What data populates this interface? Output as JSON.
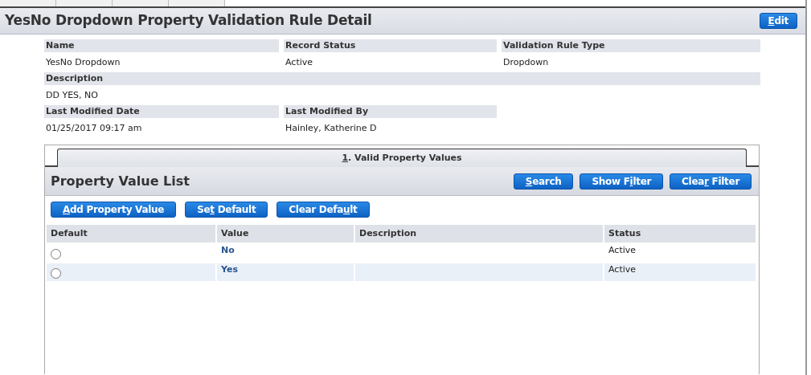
{
  "window": {
    "title": "YesNo Dropdown Property Validation Rule Detail"
  },
  "header_buttons": [
    {
      "key": "E",
      "post": "dit"
    }
  ],
  "details": [
    [
      {
        "label": "Name",
        "value": "YesNo Dropdown"
      },
      {
        "label": "Record Status",
        "value": "Active"
      },
      {
        "label": "Validation Rule Type",
        "value": "Dropdown"
      }
    ],
    [
      {
        "label": "Description",
        "value": "DD YES, NO"
      }
    ],
    [
      {
        "label": "Last Modified Date",
        "value": "01/25/2017 09:17 am"
      },
      {
        "label": "Last Modified By",
        "value": "Hainley, Katherine D"
      }
    ]
  ],
  "tabs": [
    {
      "key": "1",
      "post": ". Valid Property Values",
      "selected": true
    }
  ],
  "panel": {
    "title": "Property Value List",
    "filter_buttons": [
      {
        "key": "S",
        "post": "earch"
      },
      {
        "pre": "Show F",
        "key": "i",
        "post": "lter"
      },
      {
        "pre": "Clea",
        "key": "r",
        "post": " Filter"
      }
    ],
    "action_buttons": [
      {
        "key": "A",
        "post": "dd Property Value"
      },
      {
        "pre": "Se",
        "key": "t",
        "post": " Default"
      },
      {
        "pre": "Clear Defa",
        "key": "u",
        "post": "lt"
      }
    ]
  },
  "table": {
    "columns": [
      "Default",
      "Value",
      "Description",
      "Status"
    ],
    "rows": [
      {
        "default": false,
        "value": "No",
        "status": "Active"
      },
      {
        "default": false,
        "value": "Yes",
        "status": "Active"
      }
    ]
  }
}
